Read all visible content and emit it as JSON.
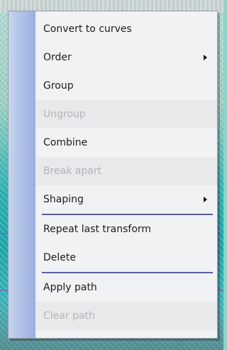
{
  "menu": {
    "items": [
      {
        "label": "Convert to curves",
        "disabled": false,
        "submenu": false
      },
      {
        "label": "Order",
        "disabled": false,
        "submenu": true
      },
      {
        "label": "Group",
        "disabled": false,
        "submenu": false
      },
      {
        "label": "Ungroup",
        "disabled": true,
        "submenu": false
      },
      {
        "label": "Combine",
        "disabled": false,
        "submenu": false
      },
      {
        "label": "Break apart",
        "disabled": true,
        "submenu": false
      },
      {
        "label": "Shaping",
        "disabled": false,
        "submenu": true
      },
      {
        "label": "Repeat last transform",
        "disabled": false,
        "submenu": false
      },
      {
        "label": "Delete",
        "disabled": false,
        "submenu": false
      },
      {
        "label": "Apply path",
        "disabled": false,
        "submenu": false
      },
      {
        "label": "Clear path",
        "disabled": true,
        "submenu": false
      }
    ]
  },
  "colors": {
    "menu_background": "#f1f2f4",
    "side_stripe": "#b0c0e6",
    "separator": "#5b5f9f",
    "disabled_text": "#b3b5b9"
  }
}
